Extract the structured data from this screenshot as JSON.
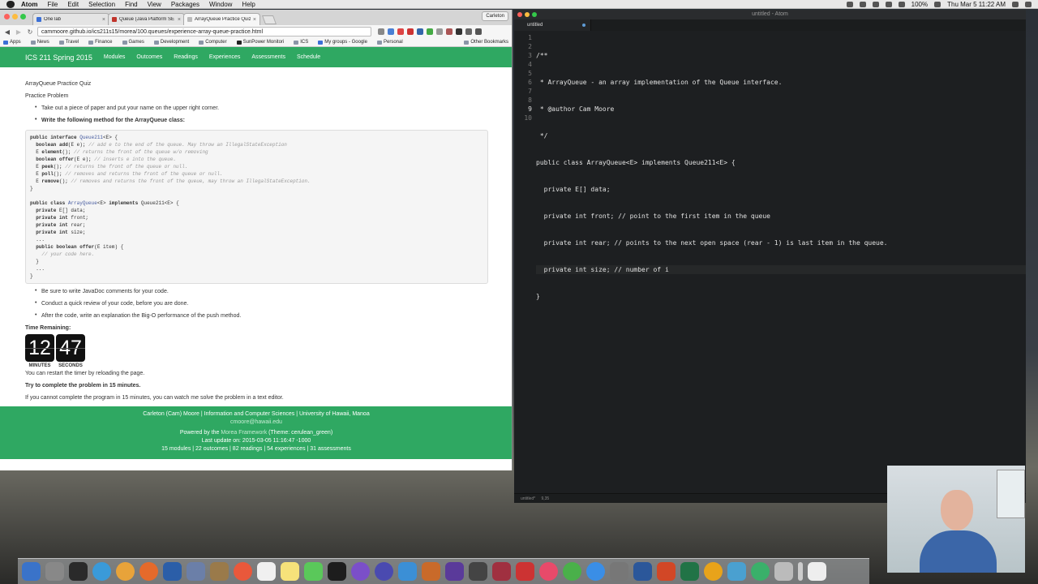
{
  "menubar": {
    "app": "Atom",
    "items": [
      "File",
      "Edit",
      "Selection",
      "Find",
      "View",
      "Packages",
      "Window",
      "Help"
    ],
    "battery": "100%",
    "clock": "Thu Mar 5  11:22 AM"
  },
  "chrome": {
    "tabs": [
      {
        "label": "OneTab",
        "favicon": "onetab-icon"
      },
      {
        "label": "Queue (Java Platform SE",
        "favicon": "java-icon"
      },
      {
        "label": "ArrayQueue Practice Quiz",
        "favicon": "page-icon"
      }
    ],
    "profile": "Carleton",
    "url": "cammoore.github.io/ics211s15/morea/100.queues/experience-array-queue-practice.html",
    "bookmarks": [
      "Apps",
      "News",
      "Travel",
      "Finance",
      "Games",
      "Development",
      "Computer",
      "SunPower Monitori",
      "ICS",
      "My groups - Google",
      "Personal"
    ],
    "other_bookmarks": "Other Bookmarks"
  },
  "site": {
    "brand": "ICS 211 Spring 2015",
    "nav": [
      "Modules",
      "Outcomes",
      "Readings",
      "Experiences",
      "Assessments",
      "Schedule"
    ],
    "page_title": "ArrayQueue Practice Quiz",
    "subtitle": "Practice Problem",
    "bullets_top": [
      "Take out a piece of paper and put your name on the upper right corner.",
      "Write the following method for the ArrayQueue class:"
    ],
    "bullets_bottom": [
      "Be sure to write JavaDoc comments for your code.",
      "Conduct a quick review of your code, before you are done.",
      "After the code, write an explanation the Big-O performance of the push method."
    ],
    "timer": {
      "label": "Time Remaining:",
      "minutes": "12",
      "seconds": "47",
      "minutes_caption": "MINUTES",
      "seconds_caption": "SECONDS"
    },
    "restart_note": "You can restart the timer by reloading the page.",
    "try_note": "Try to complete the problem in 15 minutes.",
    "cannot_note": "If you cannot complete the program in 15 minutes, you can watch me solve the problem in a text editor.",
    "footer": {
      "line1": "Carleton (Cam) Moore | Information and Computer Sciences | University of Hawaii, Manoa",
      "email": "cmoore@hawaii.edu",
      "powered_prefix": "Powered by the",
      "framework": "Morea Framework",
      "theme": "(Theme: cerulean_green)",
      "last_update": "Last update on: 2015-03-05 11:16:47 -1000",
      "stats": "15 modules | 22 outcomes | 82 readings | 54 experiences | 31 assessments"
    }
  },
  "code_sample": [
    "public interface Queue211<E> {",
    "  boolean add(E e); // add e to the end of the queue. May throw an IllegalStateException",
    "  E element(); // returns the front of the queue w/o removing",
    "  boolean offer(E e); // inserts e into the queue.",
    "  E peek(); // returns the front of the queue or null.",
    "  E poll(); // removes and returns the front of the queue or null.",
    "  E remove(); // removes and returns the front of the queue, may throw an IllegalStateException.",
    "}",
    "",
    "public class ArrayQueue<E> implements Queue211<E> {",
    "  private E[] data;",
    "  private int front;",
    "  private int rear;",
    "  private int size;",
    "  ...",
    "  public boolean offer(E item) {",
    "    // your code here.",
    "  }",
    "  ...",
    "}"
  ],
  "atom": {
    "title": "untitled - Atom",
    "tab": "untitled",
    "line_numbers": [
      "1",
      "2",
      "3",
      "4",
      "5",
      "6",
      "7",
      "8",
      "9",
      "10"
    ],
    "lines": [
      "/**",
      " * ArrayQueue - an array implementation of the Queue interface.",
      " * @author Cam Moore",
      " */",
      "public class ArrayQueue<E> implements Queue211<E> {",
      "  private E[] data;",
      "  private int front; // point to the first item in the queue",
      "  private int rear; // points to the next open space (rear - 1) is last item in the queue.",
      "  private int size; // number of i",
      "}"
    ],
    "status_file": "untitled*",
    "status_pos": "9,35"
  }
}
